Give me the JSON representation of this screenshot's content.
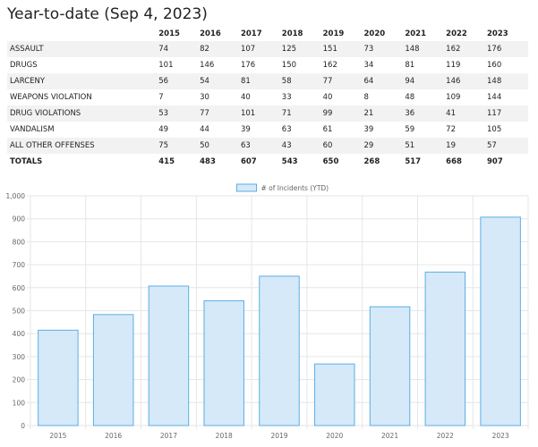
{
  "page": {
    "title": "Year-to-date (Sep 4, 2023)"
  },
  "table": {
    "years": [
      "2015",
      "2016",
      "2017",
      "2018",
      "2019",
      "2020",
      "2021",
      "2022",
      "2023"
    ],
    "rows": [
      {
        "label": "ASSAULT",
        "values": [
          "74",
          "82",
          "107",
          "125",
          "151",
          "73",
          "148",
          "162",
          "176"
        ]
      },
      {
        "label": "DRUGS",
        "values": [
          "101",
          "146",
          "176",
          "150",
          "162",
          "34",
          "81",
          "119",
          "160"
        ]
      },
      {
        "label": "LARCENY",
        "values": [
          "56",
          "54",
          "81",
          "58",
          "77",
          "64",
          "94",
          "146",
          "148"
        ]
      },
      {
        "label": "WEAPONS VIOLATION",
        "values": [
          "7",
          "30",
          "40",
          "33",
          "40",
          "8",
          "48",
          "109",
          "144"
        ]
      },
      {
        "label": "DRUG VIOLATIONS",
        "values": [
          "53",
          "77",
          "101",
          "71",
          "99",
          "21",
          "36",
          "41",
          "117"
        ]
      },
      {
        "label": "VANDALISM",
        "values": [
          "49",
          "44",
          "39",
          "63",
          "61",
          "39",
          "59",
          "72",
          "105"
        ]
      },
      {
        "label": "ALL OTHER OFFENSES",
        "values": [
          "75",
          "50",
          "63",
          "43",
          "60",
          "29",
          "51",
          "19",
          "57"
        ]
      }
    ],
    "totals": {
      "label": "TOTALS",
      "values": [
        "415",
        "483",
        "607",
        "543",
        "650",
        "268",
        "517",
        "668",
        "907"
      ]
    }
  },
  "chart_data": {
    "type": "bar",
    "categories": [
      "2015",
      "2016",
      "2017",
      "2018",
      "2019",
      "2020",
      "2021",
      "2022",
      "2023"
    ],
    "series": [
      {
        "name": "# of Incidents (YTD)",
        "values": [
          415,
          483,
          607,
          543,
          650,
          268,
          517,
          668,
          907
        ]
      }
    ],
    "ylim": [
      0,
      1000
    ],
    "yticks": [
      0,
      100,
      200,
      300,
      400,
      500,
      600,
      700,
      800,
      900,
      1000
    ],
    "ytick_labels": [
      "0",
      "100",
      "200",
      "300",
      "400",
      "500",
      "600",
      "700",
      "800",
      "900",
      "1,000"
    ],
    "grid": true,
    "legend": "top-center",
    "colors": {
      "bar_fill": "#d6e9f8",
      "bar_stroke": "#5aaee6",
      "grid": "#e6e6e6"
    }
  }
}
